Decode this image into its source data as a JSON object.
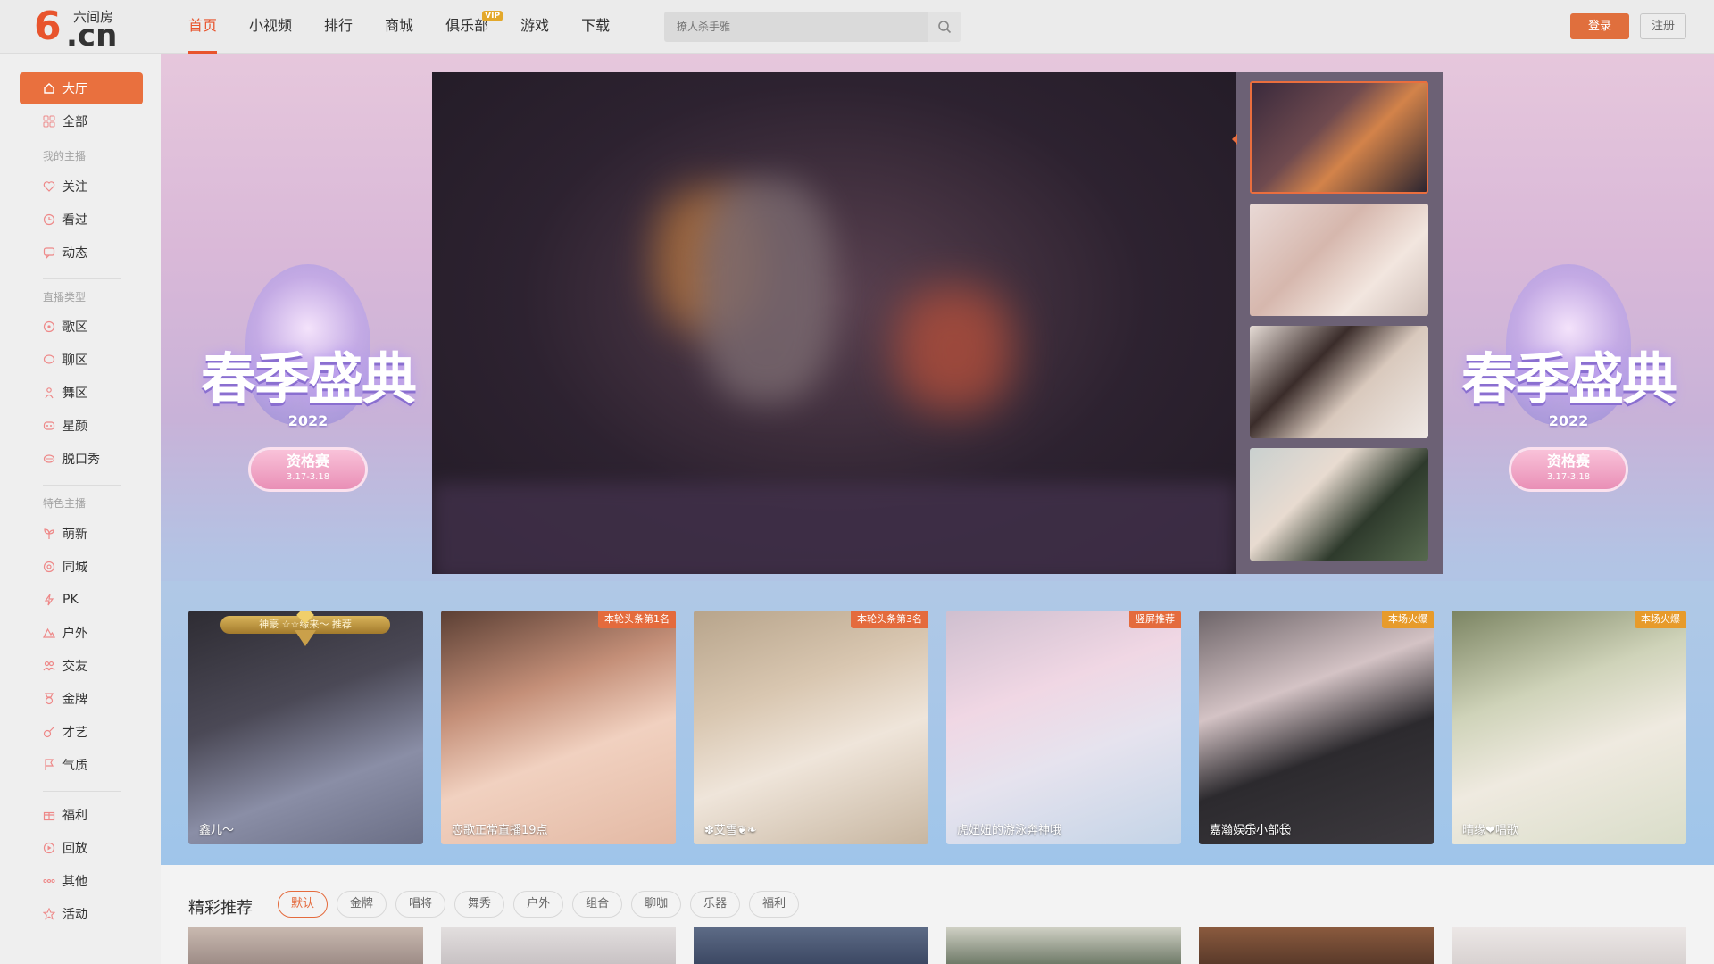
{
  "header": {
    "logo": {
      "brand_cn": "六间房",
      "domain_text": ".cn",
      "six_glyph": "6"
    },
    "nav": [
      {
        "label": "首页",
        "active": true
      },
      {
        "label": "小视频",
        "active": false
      },
      {
        "label": "排行",
        "active": false
      },
      {
        "label": "商城",
        "active": false
      },
      {
        "label": "俱乐部",
        "active": false,
        "badge": "VIP"
      },
      {
        "label": "游戏",
        "active": false
      },
      {
        "label": "下载",
        "active": false
      }
    ],
    "search": {
      "placeholder": "撩人杀手雅",
      "icon": "search-icon"
    },
    "login_label": "登录",
    "register_label": "注册"
  },
  "sidebar": {
    "items": [
      {
        "label": "大厅",
        "icon": "home-icon",
        "active": true
      },
      {
        "label": "全部",
        "icon": "grid-icon"
      }
    ],
    "sections": [
      {
        "heading": "我的主播",
        "items": [
          {
            "label": "关注",
            "icon": "heart-icon"
          },
          {
            "label": "看过",
            "icon": "clock-icon"
          },
          {
            "label": "动态",
            "icon": "message-icon"
          }
        ]
      },
      {
        "heading": "直播类型",
        "items": [
          {
            "label": "歌区",
            "icon": "music-icon"
          },
          {
            "label": "聊区",
            "icon": "chat-icon"
          },
          {
            "label": "舞区",
            "icon": "dancer-icon"
          },
          {
            "label": "星颜",
            "icon": "mask-icon"
          },
          {
            "label": "脱口秀",
            "icon": "mouth-icon"
          }
        ]
      },
      {
        "heading": "特色主播",
        "items": [
          {
            "label": "萌新",
            "icon": "sprout-icon"
          },
          {
            "label": "同城",
            "icon": "location-icon"
          },
          {
            "label": "PK",
            "icon": "lightning-icon"
          },
          {
            "label": "户外",
            "icon": "mountain-icon"
          },
          {
            "label": "交友",
            "icon": "people-icon"
          },
          {
            "label": "金牌",
            "icon": "medal-icon"
          },
          {
            "label": "才艺",
            "icon": "guitar-icon"
          },
          {
            "label": "气质",
            "icon": "flag-icon"
          }
        ]
      }
    ],
    "bottom": [
      {
        "label": "福利",
        "icon": "gift-icon"
      },
      {
        "label": "回放",
        "icon": "replay-icon"
      },
      {
        "label": "其他",
        "icon": "more-icon"
      },
      {
        "label": "活动",
        "icon": "star-icon"
      }
    ]
  },
  "banner": {
    "emblem_title": "春季盛典",
    "emblem_year": "2022",
    "emblem_pill_title": "资格赛",
    "emblem_pill_date": "3.17-3.18"
  },
  "cards": [
    {
      "name": "鑫儿～",
      "tag": "",
      "crown_text": "神豪 ☆☆缘来～ 推荐",
      "palette": [
        "#3d3a44",
        "#6f6d7f",
        "#9aa0b8"
      ]
    },
    {
      "name": "恋歌正常直播19点",
      "tag": "本轮头条第1名",
      "tag_style": "red",
      "palette": [
        "#6b4a3c",
        "#d9a58c",
        "#f2d3c3"
      ]
    },
    {
      "name": "✽艾雪❦❧",
      "tag": "本轮头条第3名",
      "tag_style": "red",
      "palette": [
        "#b9a58a",
        "#e7d6c2",
        "#f3ece2"
      ]
    },
    {
      "name": "虎妞妞的游泳奔神哦",
      "tag": "竖屏推荐",
      "tag_style": "red",
      "palette": [
        "#d6c3d0",
        "#f2dde8",
        "#c6d6ea"
      ]
    },
    {
      "name": "嘉瀚娱乐⃝小部长⃝",
      "tag": "本场火爆",
      "tag_style": "gold",
      "palette": [
        "#2c2a2e",
        "#d7c8c9",
        "#a58a8e"
      ]
    },
    {
      "name": "晴缘❤唱歌",
      "tag": "本场火爆",
      "tag_style": "gold",
      "palette": [
        "#8a8f6e",
        "#e8e3d8",
        "#cfd6b8"
      ]
    }
  ],
  "recommend": {
    "title": "精彩推荐",
    "tabs": [
      {
        "label": "默认",
        "active": true
      },
      {
        "label": "金牌"
      },
      {
        "label": "唱将"
      },
      {
        "label": "舞秀"
      },
      {
        "label": "户外"
      },
      {
        "label": "组合"
      },
      {
        "label": "聊咖"
      },
      {
        "label": "乐器"
      },
      {
        "label": "福利"
      }
    ]
  },
  "colors": {
    "accent": "#e8542d",
    "login_button": "#e06f3d",
    "sidebar_active": "#e9703e",
    "vip_badge": "#e3a82b",
    "tag_red": "#e46b3d",
    "tag_gold": "#e79b2b"
  }
}
